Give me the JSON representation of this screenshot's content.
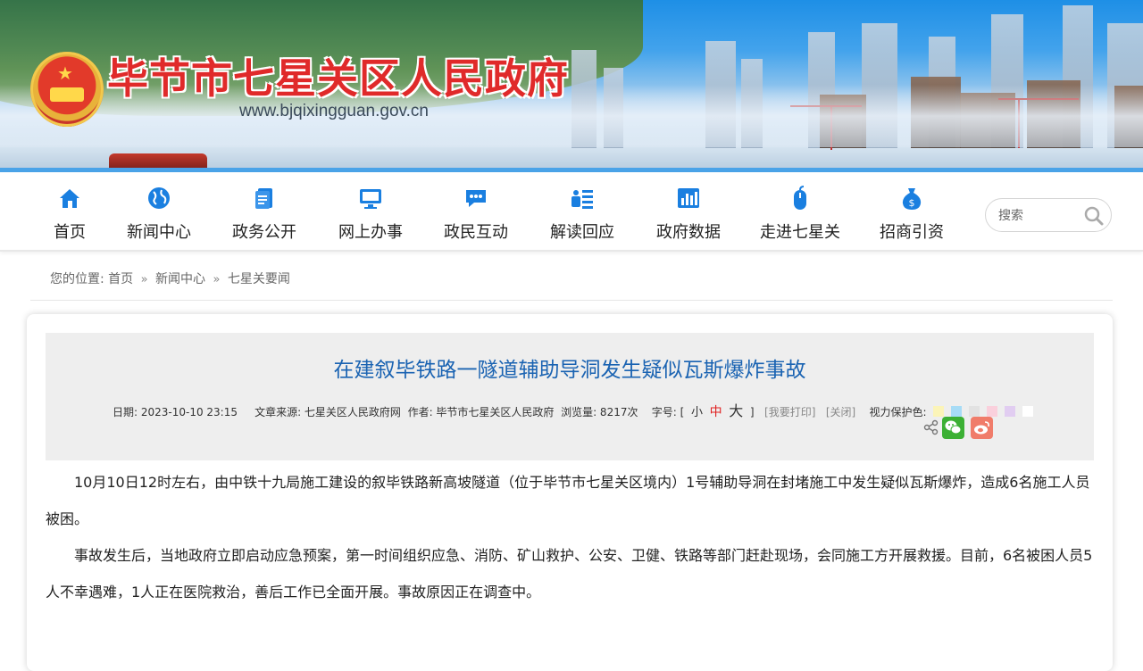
{
  "header": {
    "site_title": "毕节市七星关区人民政府",
    "site_url": "www.bjqixingguan.gov.cn"
  },
  "nav": {
    "items": [
      {
        "label": "首页",
        "icon": "home-icon"
      },
      {
        "label": "新闻中心",
        "icon": "globe-icon"
      },
      {
        "label": "政务公开",
        "icon": "document-icon"
      },
      {
        "label": "网上办事",
        "icon": "monitor-icon"
      },
      {
        "label": "政民互动",
        "icon": "chat-icon"
      },
      {
        "label": "解读回应",
        "icon": "list-icon"
      },
      {
        "label": "政府数据",
        "icon": "bar-chart-icon"
      },
      {
        "label": "走进七星关",
        "icon": "mouse-icon"
      },
      {
        "label": "招商引资",
        "icon": "money-bag-icon"
      }
    ],
    "search_placeholder": "搜索",
    "accent": "#1a7fe0"
  },
  "breadcrumb": {
    "prefix": "您的位置:",
    "items": [
      "首页",
      "新闻中心",
      "七星关要闻"
    ],
    "separator": "»"
  },
  "article": {
    "title": "在建叙毕铁路一隧道辅助导洞发生疑似瓦斯爆炸事故",
    "meta": {
      "date": "日期: 2023-10-10 23:15",
      "source": "文章来源: 七星关区人民政府网",
      "author": "作者: 毕节市七星关区人民政府",
      "views": "浏览量: 8217次",
      "font_size_label": "字号: [",
      "font_small": "小",
      "font_medium": "中",
      "font_large": "大",
      "font_close": "]",
      "print": "[我要打印]",
      "close": "[关闭]",
      "eye_care_label": "视力保护色:"
    },
    "eye_care_colors": [
      "#fbf4b8",
      "#a7dcf6",
      "#e2e2e2",
      "#fad0dc",
      "#e1cdf1",
      "#ffffff"
    ],
    "share_icons": [
      "share-icon",
      "wechat-icon",
      "weibo-icon"
    ],
    "paragraphs": [
      "10月10日12时左右，由中铁十九局施工建设的叙毕铁路新高坡隧道（位于毕节市七星关区境内）1号辅助导洞在封堵施工中发生疑似瓦斯爆炸，造成6名施工人员被困。",
      "事故发生后，当地政府立即启动应急预案，第一时间组织应急、消防、矿山救护、公安、卫健、铁路等部门赶赴现场，会同施工方开展救援。目前，6名被困人员5人不幸遇难，1人正在医院救治，善后工作已全面开展。事故原因正在调查中。"
    ]
  }
}
